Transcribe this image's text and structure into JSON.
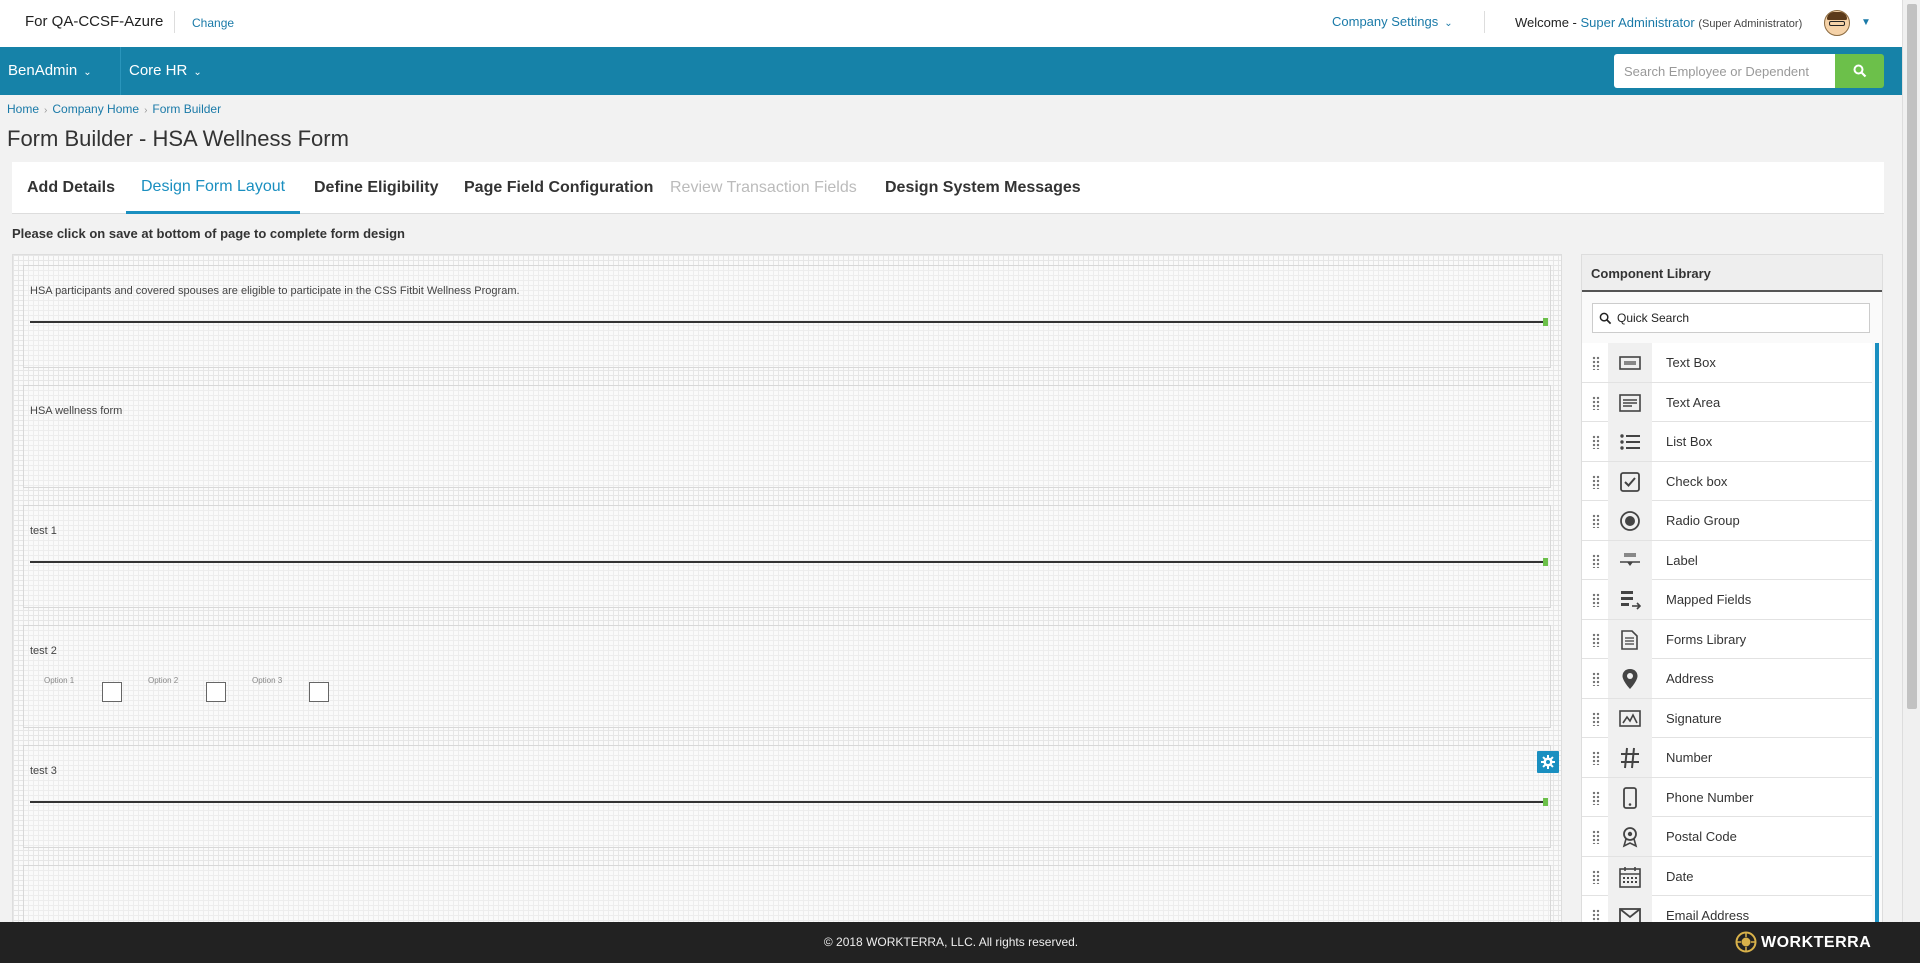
{
  "header": {
    "client_name": "For QA-CCSF-Azure",
    "change_label": "Change",
    "company_settings_label": "Company Settings",
    "welcome_prefix": "Welcome -",
    "user_name": "Super Administrator",
    "user_role": "(Super Administrator)"
  },
  "nav": {
    "items": [
      {
        "label": "BenAdmin"
      },
      {
        "label": "Core HR"
      }
    ],
    "search_placeholder": "Search Employee or Dependent"
  },
  "breadcrumb": [
    "Home",
    "Company Home",
    "Form Builder"
  ],
  "page_title": "Form Builder - HSA Wellness Form",
  "tabs": [
    {
      "label": "Add Details",
      "state": "normal"
    },
    {
      "label": "Design Form Layout",
      "state": "active"
    },
    {
      "label": "Define Eligibility",
      "state": "normal"
    },
    {
      "label": "Page Field Configuration",
      "state": "normal"
    },
    {
      "label": "Review Transaction Fields",
      "state": "disabled"
    },
    {
      "label": "Design System Messages",
      "state": "normal"
    }
  ],
  "instructions": "Please click on save at bottom of page to complete form design",
  "canvas": {
    "fields": [
      {
        "label": "HSA participants and covered spouses are eligible to participate in the CSS Fitbit Wellness Program.",
        "type": "textbox"
      },
      {
        "label": "HSA wellness form",
        "type": "label"
      },
      {
        "label": "test 1",
        "type": "textbox"
      },
      {
        "label": "test 2",
        "type": "checkbox",
        "options": [
          "Option 1",
          "Option 2",
          "Option 3"
        ]
      },
      {
        "label": "test 3",
        "type": "textbox"
      }
    ]
  },
  "library": {
    "title": "Component Library",
    "search_placeholder": "Quick Search",
    "items": [
      {
        "label": "Text Box",
        "icon": "textbox-icon"
      },
      {
        "label": "Text Area",
        "icon": "textarea-icon"
      },
      {
        "label": "List Box",
        "icon": "list-icon"
      },
      {
        "label": "Check box",
        "icon": "checkbox-icon"
      },
      {
        "label": "Radio Group",
        "icon": "radio-icon"
      },
      {
        "label": "Label",
        "icon": "label-icon"
      },
      {
        "label": "Mapped Fields",
        "icon": "mapped-fields-icon"
      },
      {
        "label": "Forms Library",
        "icon": "forms-library-icon"
      },
      {
        "label": "Address",
        "icon": "location-pin-icon"
      },
      {
        "label": "Signature",
        "icon": "signature-icon"
      },
      {
        "label": "Number",
        "icon": "hash-icon"
      },
      {
        "label": "Phone Number",
        "icon": "phone-icon"
      },
      {
        "label": "Postal Code",
        "icon": "postal-code-icon"
      },
      {
        "label": "Date",
        "icon": "calendar-icon"
      },
      {
        "label": "Email Address",
        "icon": "envelope-icon"
      }
    ]
  },
  "footer": {
    "copyright": "© 2018 WORKTERRA, LLC. All rights reserved.",
    "brand": "WORKTERRA"
  },
  "colors": {
    "nav_bg": "#1682a8",
    "accent": "#1a8fc0",
    "search_button": "#6cc04a",
    "footer_bg": "#222222"
  }
}
